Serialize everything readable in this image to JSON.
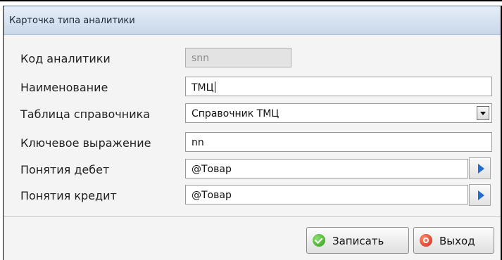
{
  "window": {
    "title": "Карточка типа аналитики"
  },
  "form": {
    "code": {
      "label": "Код аналитики",
      "value": "snn"
    },
    "name": {
      "label": "Наименование",
      "value": "ТМЦ"
    },
    "table": {
      "label": "Таблица справочника",
      "value": "Справочник ТМЦ"
    },
    "key": {
      "label": "Ключевое выражение",
      "value": "nn"
    },
    "debit": {
      "label": "Понятия дебет",
      "value": "@Товар"
    },
    "credit": {
      "label": "Понятия кредит",
      "value": "@Товар"
    }
  },
  "buttons": {
    "save": "Записать",
    "exit": "Выход"
  },
  "icons": {
    "dropdown": "chevron-down-icon",
    "browse": "play-arrow-icon",
    "save": "check-circle-icon",
    "exit": "power-icon"
  },
  "colors": {
    "titlebar": "#cfdcec",
    "browse_arrow": "#1f6ed4",
    "save_icon": "#3aa822",
    "exit_icon": "#d93a2a"
  }
}
